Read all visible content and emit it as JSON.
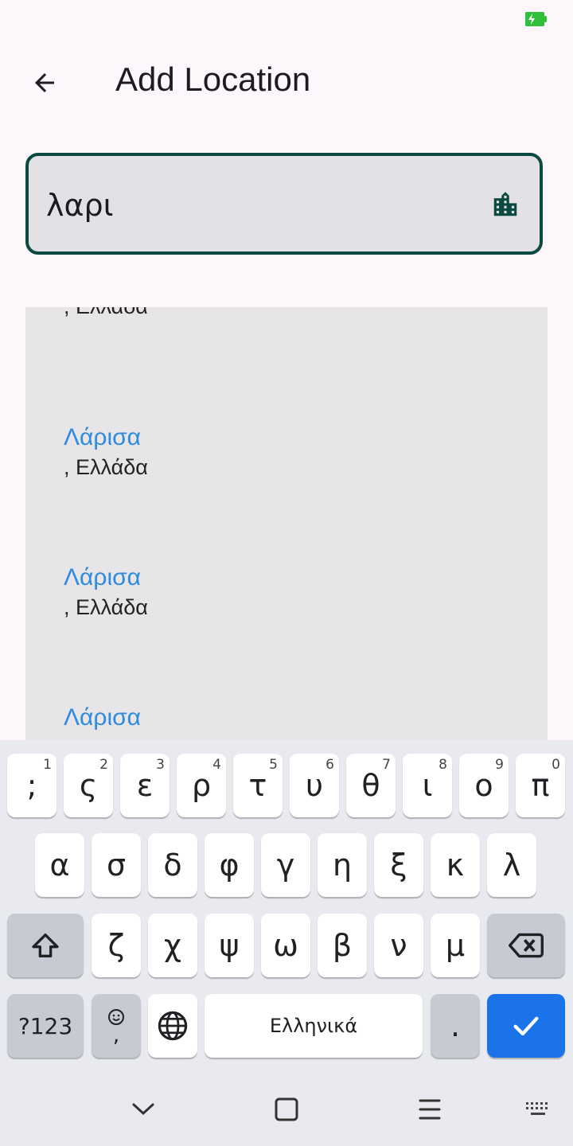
{
  "app": {
    "title": "Add Location"
  },
  "search": {
    "value": "λαρι"
  },
  "results": [
    {
      "name": "",
      "country": ", Ελλάδα"
    },
    {
      "name": "Λάρισα",
      "country": ", Ελλάδα"
    },
    {
      "name": "Λάρισα",
      "country": ", Ελλάδα"
    },
    {
      "name": "Λάρισα",
      "country": ""
    }
  ],
  "keyboard": {
    "row1": [
      {
        "char": ";",
        "hint": "1"
      },
      {
        "char": "ς",
        "hint": "2"
      },
      {
        "char": "ε",
        "hint": "3"
      },
      {
        "char": "ρ",
        "hint": "4"
      },
      {
        "char": "τ",
        "hint": "5"
      },
      {
        "char": "υ",
        "hint": "6"
      },
      {
        "char": "θ",
        "hint": "7"
      },
      {
        "char": "ι",
        "hint": "8"
      },
      {
        "char": "ο",
        "hint": "9"
      },
      {
        "char": "π",
        "hint": "0"
      }
    ],
    "row2": [
      "α",
      "σ",
      "δ",
      "φ",
      "γ",
      "η",
      "ξ",
      "κ",
      "λ"
    ],
    "row3": [
      "ζ",
      "χ",
      "ψ",
      "ω",
      "β",
      "ν",
      "μ"
    ],
    "symbols_label": "?123",
    "comma_label": ",",
    "space_label": "Ελληνικά",
    "period_label": ".",
    "accent_color": "#1a73e8"
  },
  "icons": {
    "back": "arrow-left-icon",
    "city": "city-buildings-icon",
    "shift": "shift-icon",
    "backspace": "backspace-icon",
    "emoji": "emoji-icon",
    "globe": "globe-icon",
    "enter": "check-icon"
  },
  "colors": {
    "field_border": "#0a4a40",
    "result_name": "#2d8be0",
    "background": "#fdf7fc"
  }
}
